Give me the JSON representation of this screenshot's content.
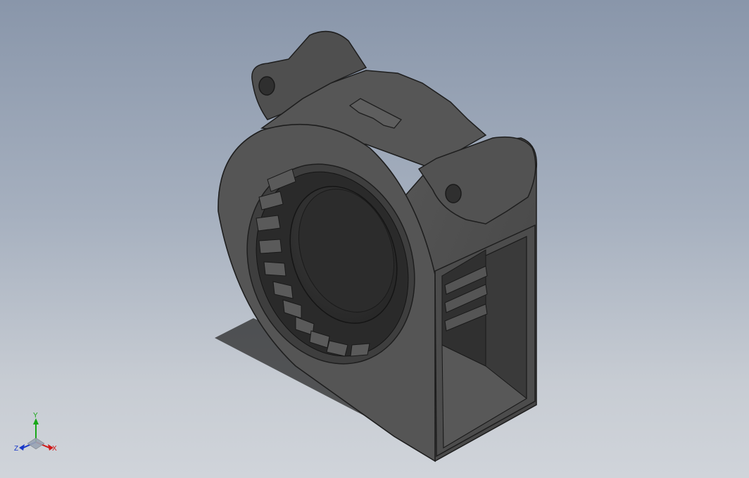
{
  "viewport": {
    "background_top": "#8996aa",
    "background_bottom": "#d0d4da",
    "model_color": "#4a4a4a",
    "edge_color": "#1e1e1e"
  },
  "triad": {
    "x_label": "X",
    "y_label": "Y",
    "z_label": "Z",
    "x_color": "#d01818",
    "y_color": "#18a818",
    "z_color": "#1838c8"
  }
}
